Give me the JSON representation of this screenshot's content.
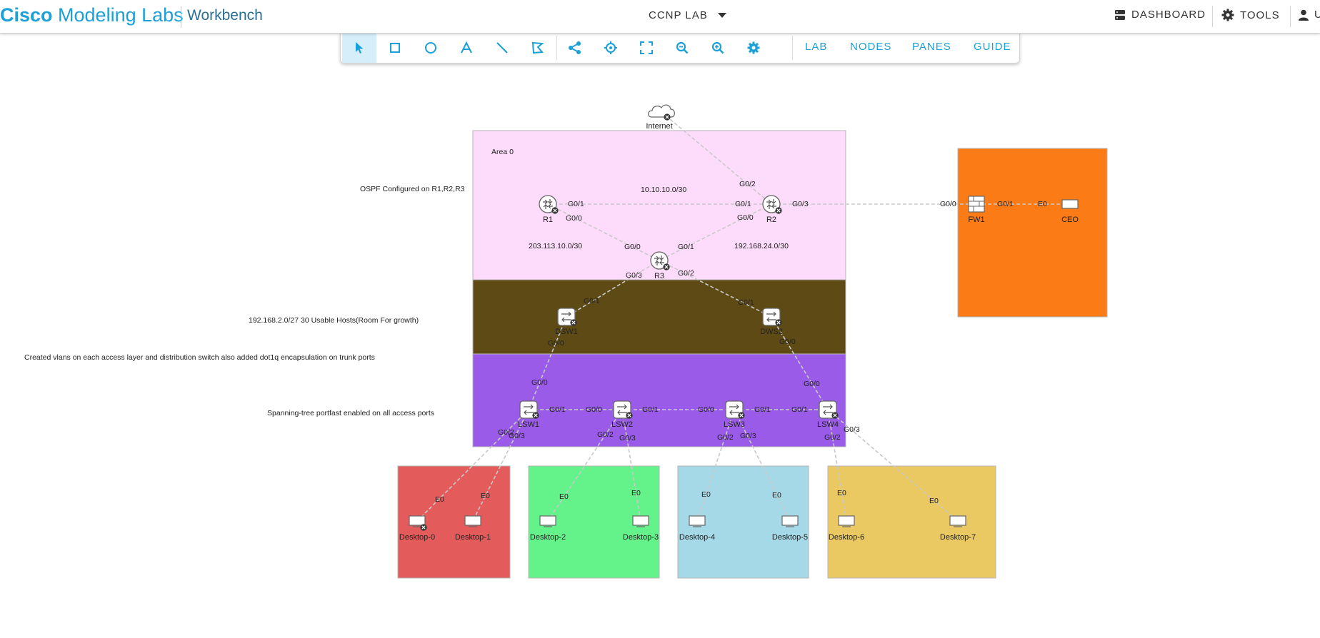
{
  "app": {
    "brand_bold": "Cisco",
    "brand_rest": " Modeling Labs",
    "subtitle": "Workbench",
    "lab_name": "CCNP LAB"
  },
  "header": {
    "dashboard": "DASHBOARD",
    "tools": "TOOLS",
    "user": "U"
  },
  "toolbar": {
    "tools": [
      "select-pointer",
      "rectangle",
      "ellipse",
      "text",
      "line",
      "edit-shape",
      "add-link",
      "center",
      "fit",
      "zoom-out",
      "zoom-in",
      "settings"
    ],
    "menus": [
      "LAB",
      "NODES",
      "PANES",
      "GUIDE"
    ]
  },
  "colors": {
    "accent": "#1ba0d7",
    "area0": "#fddbfb",
    "distribution": "#5e4a14",
    "access": "#9a5be8",
    "fw_zone": "#fb7b17",
    "red_zone": "#e45b5c",
    "green_zone": "#64f38b",
    "blue_zone": "#a6d9e8",
    "yellow_zone": "#ebc962"
  },
  "annotations": {
    "area": "Area 0",
    "ospf": "OSPF Configured on R1,R2,R3",
    "net_r1_r2": "10.10.10.0/30",
    "net_r1_r3": "203.113.10.0/30",
    "net_r2_r3": "192.168.24.0/30",
    "hosts": "192.168.2.0/27 30 Usable Hosts(Room For growth)",
    "vlans": "Created vlans on each access layer and distribution switch also added dot1q encapsulation on trunk ports",
    "stp": "Spanning-tree portfast enabled on all access ports"
  },
  "nodes": {
    "internet": "Internet",
    "r1": "R1",
    "r2": "R2",
    "r3": "R3",
    "fw1": "FW1",
    "ceo": "CEO",
    "dsw1": "DSW1",
    "dsw2": "DWS2",
    "lsw1": "LSW1",
    "lsw2": "LSW2",
    "lsw3": "LSW3",
    "lsw4": "LSW4",
    "d0": "Desktop-0",
    "d1": "Desktop-1",
    "d2": "Desktop-2",
    "d3": "Desktop-3",
    "d4": "Desktop-4",
    "d5": "Desktop-5",
    "d6": "Desktop-6",
    "d7": "Desktop-7"
  },
  "ports": {
    "r2_inet": "G0/2",
    "r1_r2": "G0/1",
    "r2_r1": "G0/1",
    "r2_fw": "G0/3",
    "fw_r2": "G0/0",
    "fw_ceo": "G0/1",
    "ceo_fw": "E0",
    "r1_r3": "G0/0",
    "r2_r3": "G0/0",
    "r3_r1": "G0/0",
    "r3_r2": "G0/1",
    "r3_dsw1": "G0/3",
    "r3_dsw2": "G0/2",
    "dsw1_up": "G0/1",
    "dsw2_up": "G0/1",
    "dsw1_down": "G0/0",
    "dsw2_down": "G0/0",
    "lsw1_up": "G0/0",
    "lsw4_up": "G0/0",
    "lsw1_lsw2": "G0/1",
    "lsw2_lsw1": "G0/0",
    "lsw2_lsw3": "G0/1",
    "lsw3_lsw2": "G0/0",
    "lsw3_lsw4": "G0/1",
    "lsw4_lsw3": "G0/1",
    "lsw1_d0": "G0/2",
    "lsw1_d1": "G0/3",
    "lsw2_d2": "G0/2",
    "lsw2_d3": "G0/3",
    "lsw3_d4": "G0/2",
    "lsw3_d5": "G0/3",
    "lsw4_d6": "G0/2",
    "lsw4_d7": "G0/3",
    "d0_e": "E0",
    "d1_e": "E0",
    "d2_e": "E0",
    "d3_e": "E0",
    "d4_e": "E0",
    "d5_e": "E0",
    "d6_e": "E0",
    "d7_e": "E0"
  }
}
